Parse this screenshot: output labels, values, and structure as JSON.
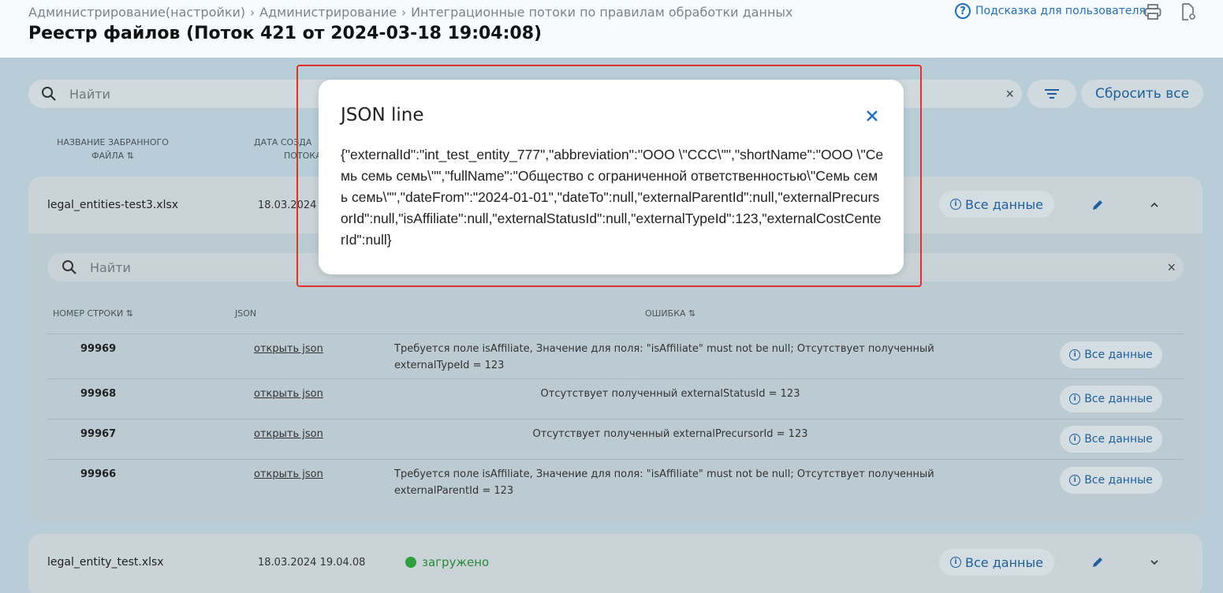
{
  "header": {
    "breadcrumbs": [
      "Администрирование(настройки)",
      "Администрирование",
      "Интеграционные потоки по правилам обработки данных"
    ],
    "title": "Реестр файлов (Поток 421 от 2024-03-18 19:04:08)",
    "hint_label": "Подсказка для пользователя",
    "icons": [
      "help-icon",
      "print-icon",
      "document-settings-icon"
    ]
  },
  "search": {
    "placeholder": "Найти"
  },
  "toolbar": {
    "reset_label": "Сбросить все"
  },
  "file_table": {
    "columns": [
      "НАЗВАНИЕ ЗАБРАННОГО ФАЙЛА",
      "ДАТА СОЗДАНИЯ ПОТОКА"
    ],
    "column_visible": [
      "НАЗВАНИЕ ЗАБРАННОГО\nФАЙЛА",
      "ДАТА СОЗДА\nПОТОКА"
    ],
    "files": [
      {
        "name": "legal_entities-test3.xlsx",
        "date": "18.03.2024",
        "all_data_label": "Все данные",
        "expanded": true
      },
      {
        "name": "legal_entity_test.xlsx",
        "date": "18.03.2024 19.04.08",
        "status": "загружено",
        "all_data_label": "Все данные",
        "expanded": false
      }
    ]
  },
  "inner": {
    "search_placeholder": "Найти",
    "columns": [
      "НОМЕР СТРОКИ",
      "JSON",
      "ОШИБКА"
    ],
    "rows": [
      {
        "num": "99969",
        "json_link": "открыть json",
        "error": "Требуется поле isAffiliate, Значение для поля: \"isAffiliate\" must not be null; Отсутствует полученный externalTypeId = 123",
        "all_data_label": "Все данные"
      },
      {
        "num": "99968",
        "json_link": "открыть json",
        "error": "Отсутствует полученный externalStatusId = 123",
        "all_data_label": "Все данные"
      },
      {
        "num": "99967",
        "json_link": "открыть json",
        "error": "Отсутствует полученный externalPrecursorId = 123",
        "all_data_label": "Все данные"
      },
      {
        "num": "99966",
        "json_link": "открыть json",
        "error": "Требуется поле isAffiliate, Значение для поля: \"isAffiliate\" must not be null; Отсутствует полученный externalParentId = 123",
        "all_data_label": "Все данные"
      }
    ]
  },
  "modal": {
    "title": "JSON line",
    "body": "{\"externalId\":\"int_test_entity_777\",\"abbreviation\":\"ООО \\\"ССС\\\"\",\"shortName\":\"ООО \\\"Семь семь семь\\\"\",\"fullName\":\"Общество с ограниченной ответственностью\\\"Семь семь семь\\\"\",\"dateFrom\":\"2024-01-01\",\"dateTo\":null,\"externalParentId\":null,\"externalPrecursorId\":null,\"isAffiliate\":null,\"externalStatusId\":null,\"externalTypeId\":123,\"externalCostCenterId\":null}"
  },
  "colors": {
    "accent": "#1f6fbf",
    "highlight": "#e0312f",
    "success": "#2f9e3f"
  }
}
